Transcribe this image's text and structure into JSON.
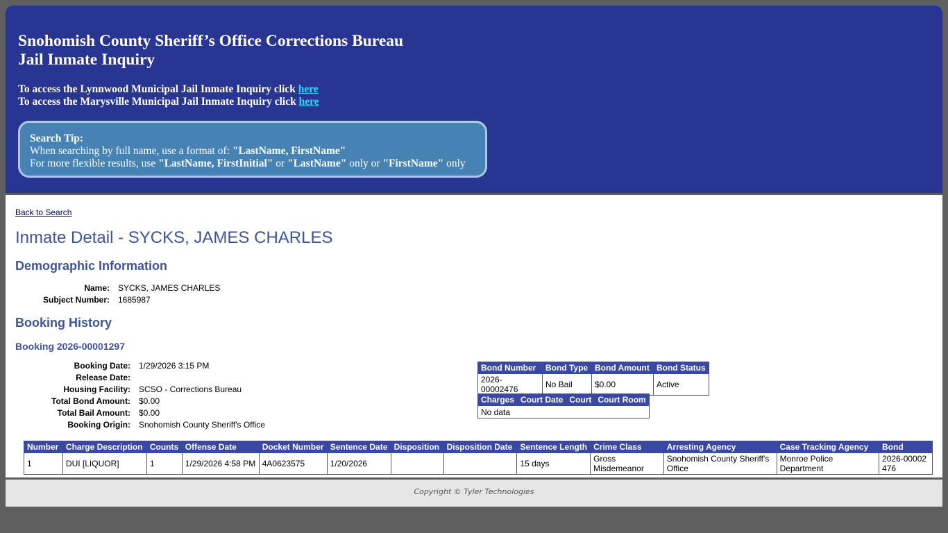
{
  "header": {
    "title_line1": "Snohomish County Sheriff’s Office Corrections Bureau",
    "title_line2": "Jail Inmate Inquiry",
    "lynnwood_text": "To access the Lynnwood Municipal Jail Inmate Inquiry click",
    "marysville_text": "To access the Marysville Municipal Jail Inmate Inquiry click",
    "link_label": "here"
  },
  "tip": {
    "heading": "Search Tip:",
    "line1_prefix": "When searching by full name, use a format of: ",
    "line1_bold": "\"LastName, FirstName\"",
    "line2_prefix": "For more flexible results, use ",
    "line2_bold1": "\"LastName, FirstInitial\"",
    "line2_mid1": " or ",
    "line2_bold2": "\"LastName\"",
    "line2_mid2": " only or ",
    "line2_bold3": "\"FirstName\"",
    "line2_suffix": " only"
  },
  "back_link": "Back to Search",
  "inmate_title": "Inmate Detail - SYCKS, JAMES CHARLES",
  "demographic": {
    "heading": "Demographic Information",
    "name_label": "Name:",
    "name_value": "SYCKS, JAMES CHARLES",
    "subject_label": "Subject Number:",
    "subject_value": "1685987"
  },
  "booking_history_heading": "Booking History",
  "booking": {
    "heading": "Booking 2026-00001297",
    "fields": [
      {
        "label": "Booking Date:",
        "value": "1/29/2026 3:15 PM"
      },
      {
        "label": "Release Date:",
        "value": ""
      },
      {
        "label": "Housing Facility:",
        "value": "SCSO - Corrections Bureau"
      },
      {
        "label": "Total Bond Amount:",
        "value": "$0.00"
      },
      {
        "label": "Total Bail Amount:",
        "value": "$0.00"
      },
      {
        "label": "Booking Origin:",
        "value": "Snohomish County Sheriff's Office"
      }
    ]
  },
  "bond_table": {
    "headers": [
      "Bond Number",
      "Bond Type",
      "Bond Amount",
      "Bond Status"
    ],
    "rows": [
      [
        "2026-00002476",
        "No Bail",
        "$0.00",
        "Active"
      ]
    ]
  },
  "court_table": {
    "headers": [
      "Charges",
      "Court Date",
      "Court",
      "Court Room"
    ],
    "empty_text": "No data"
  },
  "charges_table": {
    "headers": [
      "Number",
      "Charge Description",
      "Counts",
      "Offense Date",
      "Docket Number",
      "Sentence Date",
      "Disposition",
      "Disposition Date",
      "Sentence Length",
      "Crime Class",
      "Arresting Agency",
      "Case Tracking Agency",
      "Bond"
    ],
    "rows": [
      [
        "1",
        "DUI [LIQUOR]",
        "1",
        "1/29/2026 4:58 PM",
        "4A0623575",
        "1/20/2026",
        "",
        "",
        "15 days",
        "Gross Misdemeanor",
        "Snohomish County Sheriff's Office",
        "Monroe Police Department",
        "2026-00002476"
      ]
    ]
  },
  "footer": "Copyright © Tyler Technologies"
}
